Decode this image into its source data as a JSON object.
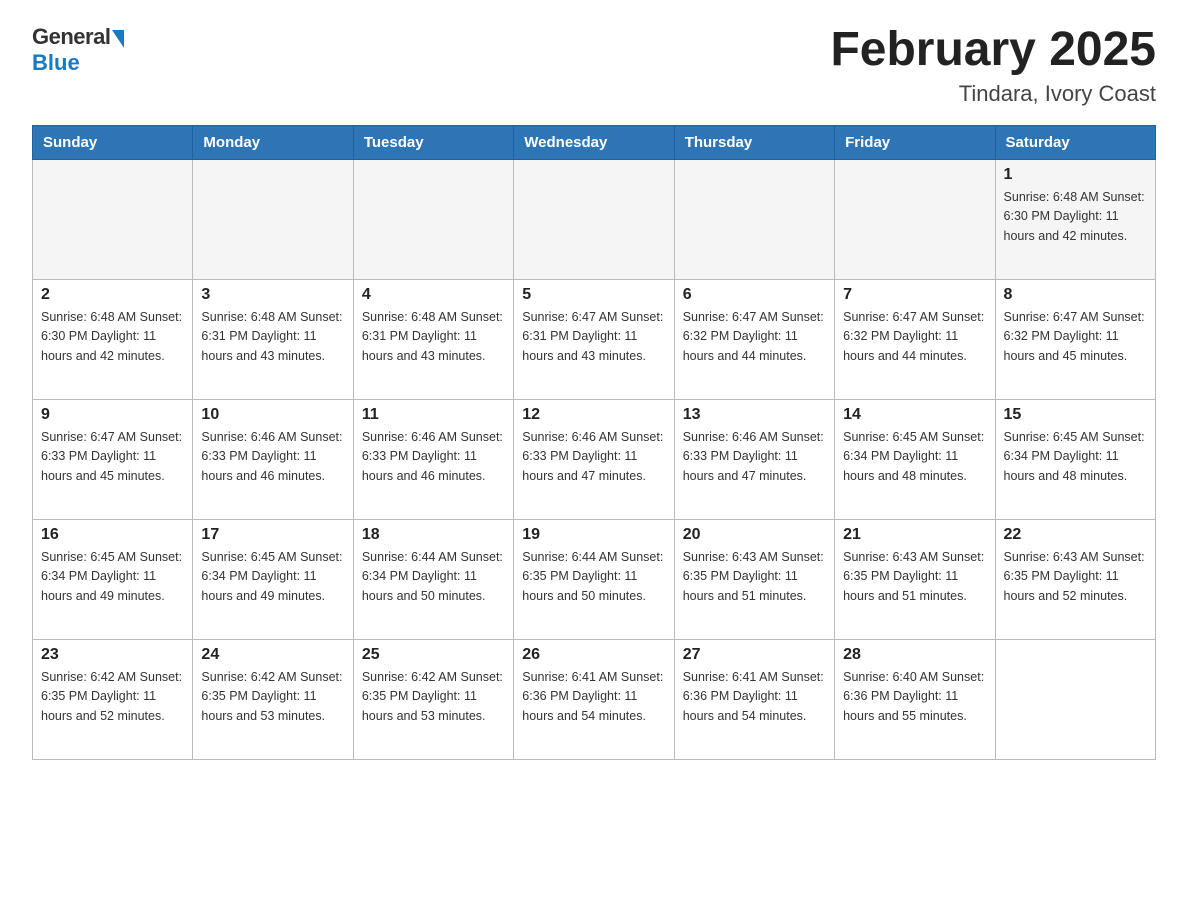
{
  "logo": {
    "general": "General",
    "blue": "Blue"
  },
  "title": "February 2025",
  "location": "Tindara, Ivory Coast",
  "days_of_week": [
    "Sunday",
    "Monday",
    "Tuesday",
    "Wednesday",
    "Thursday",
    "Friday",
    "Saturday"
  ],
  "weeks": [
    [
      {
        "day": "",
        "info": ""
      },
      {
        "day": "",
        "info": ""
      },
      {
        "day": "",
        "info": ""
      },
      {
        "day": "",
        "info": ""
      },
      {
        "day": "",
        "info": ""
      },
      {
        "day": "",
        "info": ""
      },
      {
        "day": "1",
        "info": "Sunrise: 6:48 AM\nSunset: 6:30 PM\nDaylight: 11 hours\nand 42 minutes."
      }
    ],
    [
      {
        "day": "2",
        "info": "Sunrise: 6:48 AM\nSunset: 6:30 PM\nDaylight: 11 hours\nand 42 minutes."
      },
      {
        "day": "3",
        "info": "Sunrise: 6:48 AM\nSunset: 6:31 PM\nDaylight: 11 hours\nand 43 minutes."
      },
      {
        "day": "4",
        "info": "Sunrise: 6:48 AM\nSunset: 6:31 PM\nDaylight: 11 hours\nand 43 minutes."
      },
      {
        "day": "5",
        "info": "Sunrise: 6:47 AM\nSunset: 6:31 PM\nDaylight: 11 hours\nand 43 minutes."
      },
      {
        "day": "6",
        "info": "Sunrise: 6:47 AM\nSunset: 6:32 PM\nDaylight: 11 hours\nand 44 minutes."
      },
      {
        "day": "7",
        "info": "Sunrise: 6:47 AM\nSunset: 6:32 PM\nDaylight: 11 hours\nand 44 minutes."
      },
      {
        "day": "8",
        "info": "Sunrise: 6:47 AM\nSunset: 6:32 PM\nDaylight: 11 hours\nand 45 minutes."
      }
    ],
    [
      {
        "day": "9",
        "info": "Sunrise: 6:47 AM\nSunset: 6:33 PM\nDaylight: 11 hours\nand 45 minutes."
      },
      {
        "day": "10",
        "info": "Sunrise: 6:46 AM\nSunset: 6:33 PM\nDaylight: 11 hours\nand 46 minutes."
      },
      {
        "day": "11",
        "info": "Sunrise: 6:46 AM\nSunset: 6:33 PM\nDaylight: 11 hours\nand 46 minutes."
      },
      {
        "day": "12",
        "info": "Sunrise: 6:46 AM\nSunset: 6:33 PM\nDaylight: 11 hours\nand 47 minutes."
      },
      {
        "day": "13",
        "info": "Sunrise: 6:46 AM\nSunset: 6:33 PM\nDaylight: 11 hours\nand 47 minutes."
      },
      {
        "day": "14",
        "info": "Sunrise: 6:45 AM\nSunset: 6:34 PM\nDaylight: 11 hours\nand 48 minutes."
      },
      {
        "day": "15",
        "info": "Sunrise: 6:45 AM\nSunset: 6:34 PM\nDaylight: 11 hours\nand 48 minutes."
      }
    ],
    [
      {
        "day": "16",
        "info": "Sunrise: 6:45 AM\nSunset: 6:34 PM\nDaylight: 11 hours\nand 49 minutes."
      },
      {
        "day": "17",
        "info": "Sunrise: 6:45 AM\nSunset: 6:34 PM\nDaylight: 11 hours\nand 49 minutes."
      },
      {
        "day": "18",
        "info": "Sunrise: 6:44 AM\nSunset: 6:34 PM\nDaylight: 11 hours\nand 50 minutes."
      },
      {
        "day": "19",
        "info": "Sunrise: 6:44 AM\nSunset: 6:35 PM\nDaylight: 11 hours\nand 50 minutes."
      },
      {
        "day": "20",
        "info": "Sunrise: 6:43 AM\nSunset: 6:35 PM\nDaylight: 11 hours\nand 51 minutes."
      },
      {
        "day": "21",
        "info": "Sunrise: 6:43 AM\nSunset: 6:35 PM\nDaylight: 11 hours\nand 51 minutes."
      },
      {
        "day": "22",
        "info": "Sunrise: 6:43 AM\nSunset: 6:35 PM\nDaylight: 11 hours\nand 52 minutes."
      }
    ],
    [
      {
        "day": "23",
        "info": "Sunrise: 6:42 AM\nSunset: 6:35 PM\nDaylight: 11 hours\nand 52 minutes."
      },
      {
        "day": "24",
        "info": "Sunrise: 6:42 AM\nSunset: 6:35 PM\nDaylight: 11 hours\nand 53 minutes."
      },
      {
        "day": "25",
        "info": "Sunrise: 6:42 AM\nSunset: 6:35 PM\nDaylight: 11 hours\nand 53 minutes."
      },
      {
        "day": "26",
        "info": "Sunrise: 6:41 AM\nSunset: 6:36 PM\nDaylight: 11 hours\nand 54 minutes."
      },
      {
        "day": "27",
        "info": "Sunrise: 6:41 AM\nSunset: 6:36 PM\nDaylight: 11 hours\nand 54 minutes."
      },
      {
        "day": "28",
        "info": "Sunrise: 6:40 AM\nSunset: 6:36 PM\nDaylight: 11 hours\nand 55 minutes."
      },
      {
        "day": "",
        "info": ""
      }
    ]
  ]
}
